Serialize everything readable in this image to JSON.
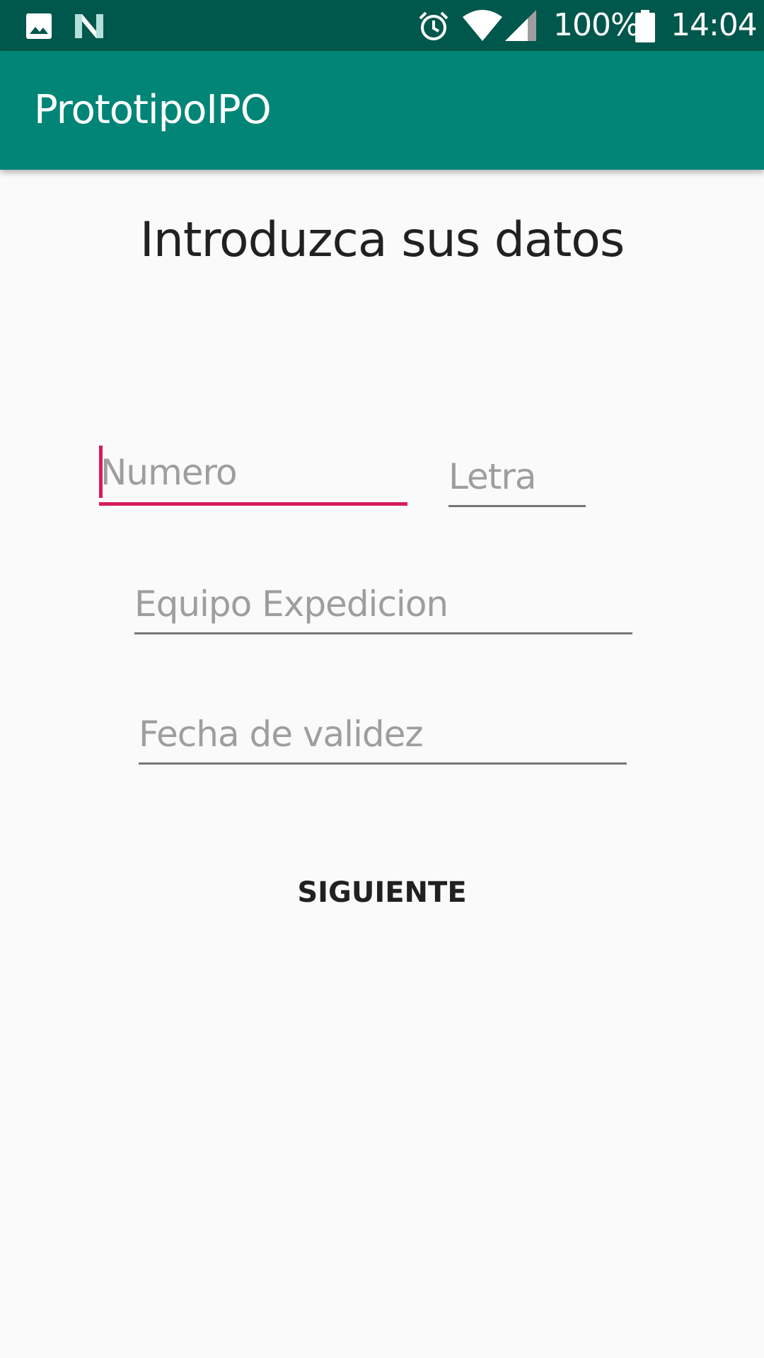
{
  "status_bar": {
    "battery_text": "100%",
    "time": "14:04",
    "icons": [
      "image-icon",
      "n-logo-icon",
      "alarm-icon",
      "wifi-icon",
      "cell-signal-icon",
      "battery-icon"
    ]
  },
  "app_bar": {
    "title": "PrototipoIPO"
  },
  "main": {
    "heading": "Introduzca sus datos",
    "fields": {
      "numero": {
        "hint": "Numero",
        "value": "",
        "focused": true
      },
      "letra": {
        "hint": "Letra",
        "value": ""
      },
      "equipo": {
        "hint": "Equipo Expedicion",
        "value": ""
      },
      "fecha": {
        "hint": "Fecha de validez",
        "value": ""
      }
    },
    "next_button": "SIGUIENTE"
  },
  "colors": {
    "status_bar": "#00574b",
    "app_bar": "#008577",
    "accent": "#d81b60",
    "background": "#fafafa"
  }
}
